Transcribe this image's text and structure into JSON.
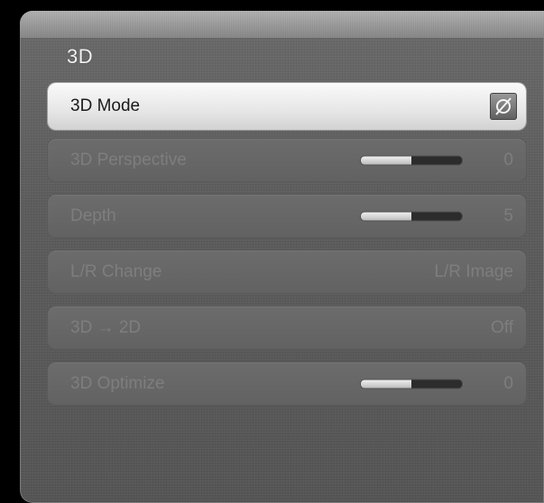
{
  "menu": {
    "title": "3D",
    "items": [
      {
        "label": "3D Mode",
        "icon": "3d-off-icon",
        "selected": true
      },
      {
        "label": "3D Perspective",
        "value": "0",
        "slider_fraction": 0.5
      },
      {
        "label": "Depth",
        "value": "5",
        "slider_fraction": 0.5
      },
      {
        "label": "L/R Change",
        "value": "L/R Image"
      },
      {
        "label": "3D → 2D",
        "value": "Off"
      },
      {
        "label": "3D Optimize",
        "value": "0",
        "slider_fraction": 0.5
      }
    ]
  }
}
